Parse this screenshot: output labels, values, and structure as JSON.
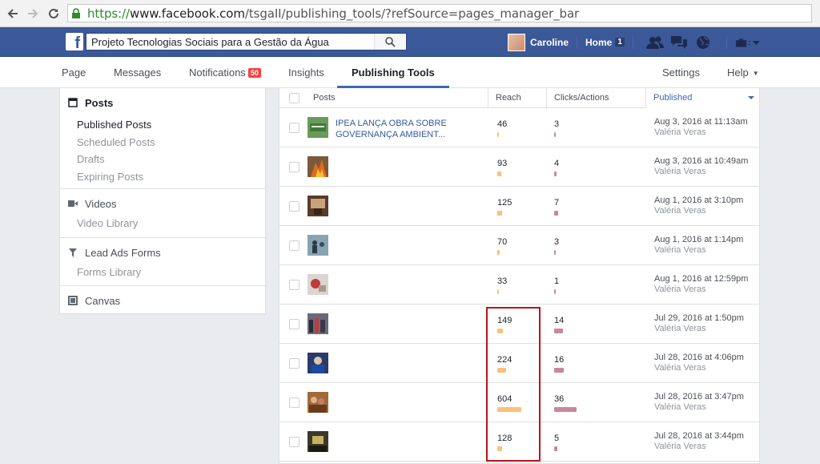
{
  "browser": {
    "url_secure": "https://",
    "url_host": "www.facebook.com",
    "url_path": "/tsgaII/publishing_tools/?refSource=pages_manager_bar"
  },
  "fbbar": {
    "search_value": "Projeto Tecnologias Sociais para a Gestão da Água",
    "user_name": "Caroline",
    "home_label": "Home",
    "home_count": "1"
  },
  "tabs": {
    "page": "Page",
    "messages": "Messages",
    "notifications": "Notifications",
    "notifications_count": "50",
    "insights": "Insights",
    "publishing_tools": "Publishing Tools",
    "settings": "Settings",
    "help": "Help"
  },
  "sidebar": {
    "posts_head": "Posts",
    "posts_items": [
      "Published Posts",
      "Scheduled Posts",
      "Drafts",
      "Expiring Posts"
    ],
    "videos_head": "Videos",
    "videos_items": [
      "Video Library"
    ],
    "leadads_head": "Lead Ads Forms",
    "leadads_items": [
      "Forms Library"
    ],
    "canvas_head": "Canvas"
  },
  "table": {
    "headers": {
      "posts": "Posts",
      "reach": "Reach",
      "clicks": "Clicks/Actions",
      "published": "Published"
    },
    "rows": [
      {
        "title": "IPEA LANÇA OBRA SOBRE GOVERNANÇA AMBIENT...",
        "reach": 46,
        "clicks": 3,
        "date": "Aug 3, 2016 at 11:13am",
        "author": "Valéria Veras",
        "thumb": "green"
      },
      {
        "title": "",
        "reach": 93,
        "clicks": 4,
        "date": "Aug 3, 2016 at 10:49am",
        "author": "Valéria Veras",
        "thumb": "fire"
      },
      {
        "title": "",
        "reach": 125,
        "clicks": 7,
        "date": "Aug 1, 2016 at 3:10pm",
        "author": "Valéria Veras",
        "thumb": "room"
      },
      {
        "title": "",
        "reach": 70,
        "clicks": 3,
        "date": "Aug 1, 2016 at 1:14pm",
        "author": "Valéria Veras",
        "thumb": "people"
      },
      {
        "title": "",
        "reach": 33,
        "clicks": 1,
        "date": "Aug 1, 2016 at 12:59pm",
        "author": "Valéria Veras",
        "thumb": "sign"
      },
      {
        "title": "",
        "reach": 149,
        "clicks": 14,
        "date": "Jul 29, 2016 at 1:50pm",
        "author": "Valéria Veras",
        "thumb": "group"
      },
      {
        "title": "",
        "reach": 224,
        "clicks": 16,
        "date": "Jul 28, 2016 at 4:06pm",
        "author": "Valéria Veras",
        "thumb": "blue"
      },
      {
        "title": "",
        "reach": 604,
        "clicks": 36,
        "date": "Jul 28, 2016 at 3:47pm",
        "author": "Valéria Veras",
        "thumb": "crowd"
      },
      {
        "title": "",
        "reach": 128,
        "clicks": 5,
        "date": "Jul 28, 2016 at 3:44pm",
        "author": "Valéria Veras",
        "thumb": "dark"
      }
    ]
  },
  "colors": {
    "fb_blue": "#3b5998",
    "reach_bar": "#f7c27c",
    "clicks_bar": "#c9879a",
    "highlight_box": "#c0121c",
    "link": "#365899"
  }
}
